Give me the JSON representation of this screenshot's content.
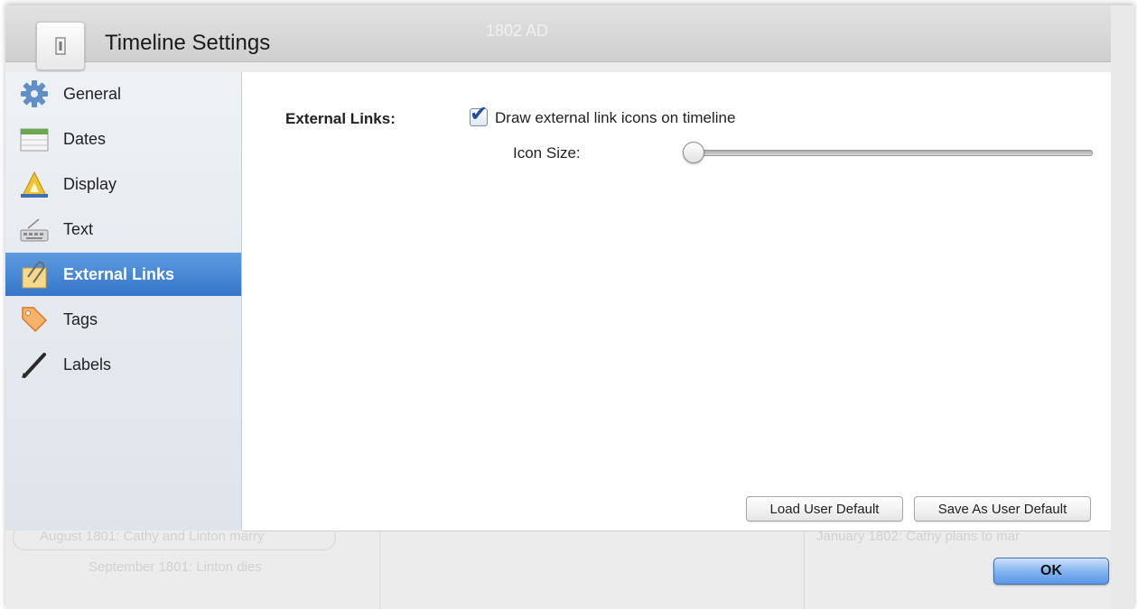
{
  "dialog": {
    "title": "Timeline Settings",
    "icon": "info-icon"
  },
  "background_timeline": {
    "header_year": "1802 AD",
    "events": [
      "August 1801: Cathy and Linton marry",
      "September 1801: Linton dies",
      "January 1802: Cathy plans to mar"
    ]
  },
  "sidebar": {
    "items": [
      {
        "label": "General",
        "icon": "gear-icon"
      },
      {
        "label": "Dates",
        "icon": "calendar-icon"
      },
      {
        "label": "Display",
        "icon": "triangle-ruler-icon"
      },
      {
        "label": "Text",
        "icon": "keyboard-icon"
      },
      {
        "label": "External Links",
        "icon": "paperclip-icon",
        "selected": true
      },
      {
        "label": "Tags",
        "icon": "tag-icon"
      },
      {
        "label": "Labels",
        "icon": "pencil-icon"
      }
    ]
  },
  "external_links": {
    "section_label": "External Links:",
    "checkbox_label": "Draw external link icons on timeline",
    "checkbox_checked": true,
    "icon_size_label": "Icon Size:",
    "icon_size_value": 0
  },
  "buttons": {
    "load_default": "Load User Default",
    "save_default": "Save As User Default",
    "ok": "OK"
  },
  "colors": {
    "selection": "#3c7dd0",
    "ok_button": "#6aa5ea"
  }
}
